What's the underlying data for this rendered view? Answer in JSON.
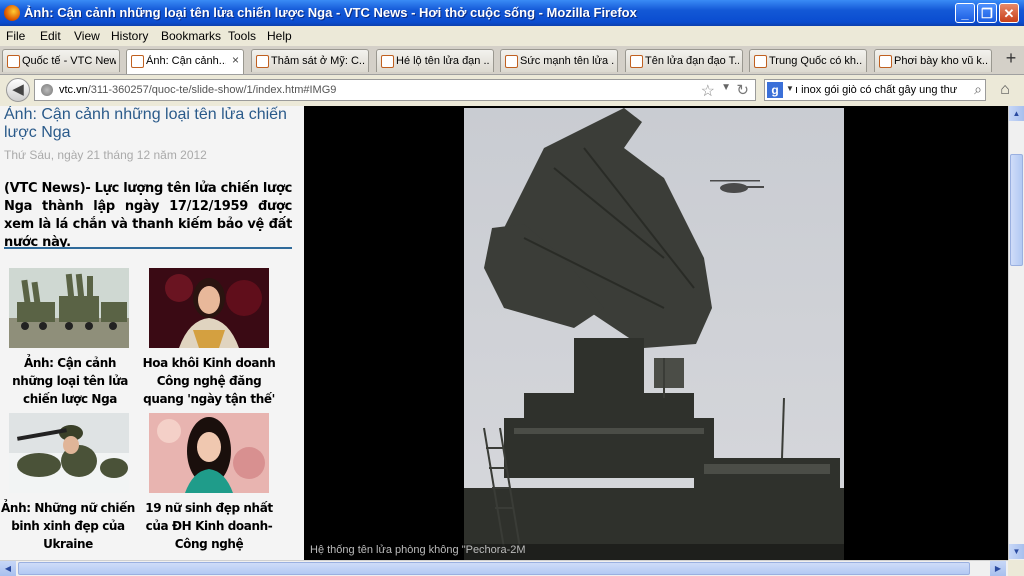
{
  "window": {
    "title": "Ảnh: Cận cảnh những loại tên lửa chiến lược Nga - VTC News - Hơi thở cuộc sống - Mozilla Firefox",
    "minimize": "_",
    "maximize": "❐",
    "close": "✕"
  },
  "menu": [
    "File",
    "Edit",
    "View",
    "History",
    "Bookmarks",
    "Tools",
    "Help"
  ],
  "tabs": [
    {
      "label": "Quốc tế - VTC News"
    },
    {
      "label": "Ảnh: Cận cảnh...",
      "active": true,
      "close": "×"
    },
    {
      "label": "Thảm sát ở Mỹ: C..."
    },
    {
      "label": "Hé lộ tên lửa đạn ..."
    },
    {
      "label": "Sức mạnh tên lửa ..."
    },
    {
      "label": "Tên lửa đạn đạo T..."
    },
    {
      "label": "Trung Quốc có kh..."
    },
    {
      "label": "Phơi bày kho vũ k..."
    }
  ],
  "new_tab": "+",
  "nav": {
    "url_host": "vtc.vn",
    "url_path": "/311-360257/quoc-te/slide-show/1/index.htm#IMG9",
    "search_engine": "g",
    "search_text": "ı inox gói giò có chất gây ung thư",
    "back_icon": "back-arrow",
    "home_icon": "home"
  },
  "article": {
    "title": "Ảnh: Cận cảnh những loại tên lửa chiến lược Nga",
    "date": "Thứ Sáu, ngày 21 tháng 12 năm 2012",
    "summary": "(VTC News)- Lực lượng tên lửa chiến lược Nga thành lập ngày 17/12/1959 được xem là lá chắn và thanh kiếm bảo vệ đất nước này."
  },
  "related": [
    {
      "caption": "Ảnh: Cận cảnh những loại tên lửa chiến lược Nga"
    },
    {
      "caption": "Hoa khôi Kinh doanh Công nghệ đăng quang 'ngày tận thế'"
    },
    {
      "caption": "Ảnh: Những nữ chiến binh xinh đẹp của Ukraine"
    },
    {
      "caption": "19 nữ sinh đẹp nhất của ĐH Kinh doanh-Công nghệ"
    }
  ],
  "slideshow": {
    "caption": "Hệ thống tên lửa phòng không \"Pechora-2M"
  },
  "colors": {
    "title_bar": "#0a4cd0",
    "article_title": "#2a5a8a",
    "rule": "#2f6a9a",
    "viewer_bg": "#000000"
  }
}
